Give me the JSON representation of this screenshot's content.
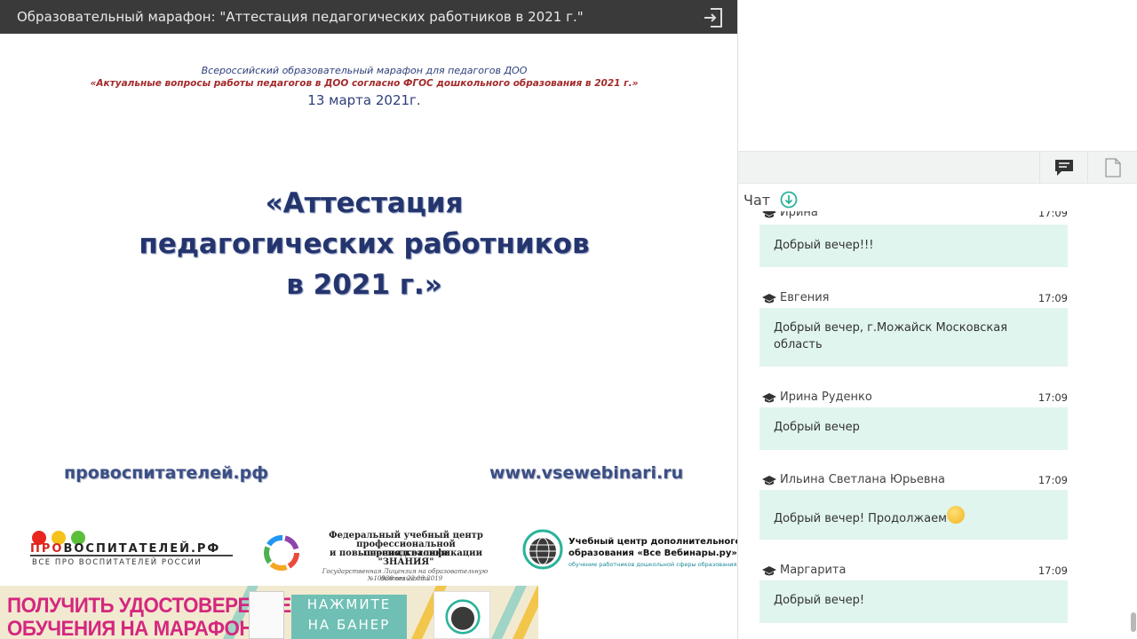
{
  "topbar": {
    "title": "Образовательный марафон: \"Аттестация педагогических работников в 2021 г.\""
  },
  "slide": {
    "header_line1": "Всероссийский образовательный марафон для педагогов  ДОО",
    "header_line2": "«Актуальные вопросы работы педагогов в ДОО согласно ФГОС дошкольного образования в 2021 г.»",
    "date": "13 марта 2021г.",
    "title_line1": "«Аттестация",
    "title_line2": "педагогических работников",
    "title_line3": "в 2021 г.»",
    "site_left": "провоспитателей.рф",
    "site_right": "www.vsewebinari.ru",
    "logo1": {
      "name_red": "ПРО",
      "name_rest": "ВОСПИТАТЕЛЕЙ.РФ",
      "tagline": "ВСЕ ПРО ВОСПИТАТЕЛЕЙ РОССИИ",
      "dot_colors": [
        "#e8251f",
        "#f5c21a",
        "#5bbf3a"
      ]
    },
    "logo2": {
      "line1": "Федеральный учебный центр",
      "line2": "профессиональной переподготовки",
      "line3": "и повышения квалификации",
      "line4": "\"ЗНАНИЯ\"",
      "license1": "Государственная Лицензия на образовательную деятельность",
      "license2": "№10930 от 22.03.2019"
    },
    "logo3": {
      "line1": "Учебный центр дополнительного",
      "line2": "образования «Все Вебинары.ру»",
      "tagline": "обучение работников дошкольной сферы образования"
    },
    "banner": {
      "left_line1": "ПОЛУЧИТЬ УДОСТОВЕРЕНИЕ",
      "left_line2": "ОБУЧЕНИЯ НА МАРАФОНЕ",
      "button_line1": "НАЖМИТЕ",
      "button_line2": "НА БАНЕР"
    }
  },
  "right_panel": {
    "tabs": [
      {
        "icon": "chat-icon",
        "active": true
      },
      {
        "icon": "document-icon",
        "active": false
      }
    ],
    "chat_label": "Чат",
    "messages": [
      {
        "author": "Ирина",
        "time": "17:09",
        "text": "Добрый вечер!!!"
      },
      {
        "author": "Евгения",
        "time": "17:09",
        "text": "Добрый вечер, г.Можайск Московская область"
      },
      {
        "author": "Ирина Руденко",
        "time": "17:09",
        "text": "Добрый вечер"
      },
      {
        "author": "Ильина Светлана Юрьевна",
        "time": "17:09",
        "text": "Добрый вечер! Продолжаем"
      },
      {
        "author": "Маргарита",
        "time": "17:09",
        "text": "Добрый вечер!"
      }
    ]
  },
  "colors": {
    "topbar_bg": "#3a3a3a",
    "bubble_bg": "#e0f5ee",
    "title_blue": "#24356e",
    "accent_teal": "#2bb39a",
    "banner_pink": "#d5277f",
    "banner_button": "#6fbfb4"
  }
}
